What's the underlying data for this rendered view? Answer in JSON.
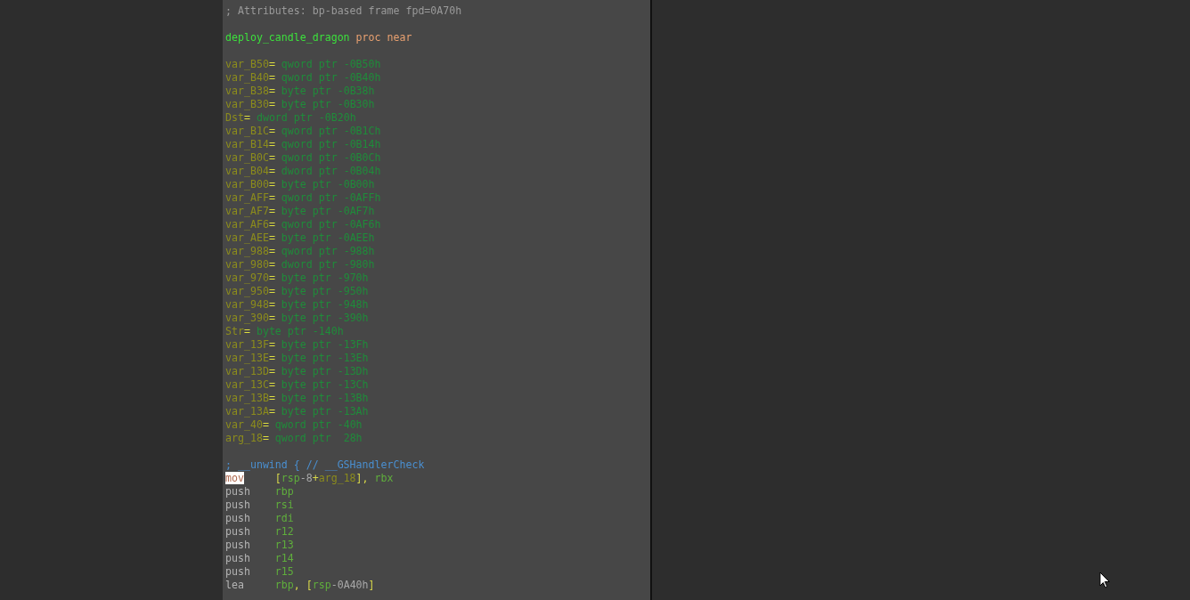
{
  "listing": [
    {
      "kind": "comment",
      "text": "; Attributes: bp-based frame fpd=0A70h"
    },
    {
      "kind": "blank"
    },
    {
      "kind": "proc",
      "name": "deploy_candle_dragon",
      "text": "proc near"
    },
    {
      "kind": "blank"
    },
    {
      "kind": "var",
      "name": "var_B50",
      "sep": "=",
      "type": "qword ptr",
      "offset": "-0B50h"
    },
    {
      "kind": "var",
      "name": "var_B40",
      "sep": "=",
      "type": "qword ptr",
      "offset": "-0B40h"
    },
    {
      "kind": "var",
      "name": "var_B38",
      "sep": "=",
      "type": "byte ptr",
      "offset": "-0B38h"
    },
    {
      "kind": "var",
      "name": "var_B30",
      "sep": "=",
      "type": "byte ptr",
      "offset": "-0B30h"
    },
    {
      "kind": "var",
      "name": "Dst",
      "sep": "=",
      "type": "dword ptr",
      "offset": "-0B20h"
    },
    {
      "kind": "var",
      "name": "var_B1C",
      "sep": "=",
      "type": "qword ptr",
      "offset": "-0B1Ch"
    },
    {
      "kind": "var",
      "name": "var_B14",
      "sep": "=",
      "type": "qword ptr",
      "offset": "-0B14h"
    },
    {
      "kind": "var",
      "name": "var_B0C",
      "sep": "=",
      "type": "qword ptr",
      "offset": "-0B0Ch"
    },
    {
      "kind": "var",
      "name": "var_B04",
      "sep": "=",
      "type": "dword ptr",
      "offset": "-0B04h"
    },
    {
      "kind": "var",
      "name": "var_B00",
      "sep": "=",
      "type": "byte ptr",
      "offset": "-0B00h"
    },
    {
      "kind": "var",
      "name": "var_AFF",
      "sep": "=",
      "type": "qword ptr",
      "offset": "-0AFFh"
    },
    {
      "kind": "var",
      "name": "var_AF7",
      "sep": "=",
      "type": "byte ptr",
      "offset": "-0AF7h"
    },
    {
      "kind": "var",
      "name": "var_AF6",
      "sep": "=",
      "type": "qword ptr",
      "offset": "-0AF6h"
    },
    {
      "kind": "var",
      "name": "var_AEE",
      "sep": "=",
      "type": "byte ptr",
      "offset": "-0AEEh"
    },
    {
      "kind": "var",
      "name": "var_988",
      "sep": "=",
      "type": "qword ptr",
      "offset": "-988h"
    },
    {
      "kind": "var",
      "name": "var_980",
      "sep": "=",
      "type": "dword ptr",
      "offset": "-980h"
    },
    {
      "kind": "var",
      "name": "var_970",
      "sep": "=",
      "type": "byte ptr",
      "offset": "-970h"
    },
    {
      "kind": "var",
      "name": "var_950",
      "sep": "=",
      "type": "byte ptr",
      "offset": "-950h"
    },
    {
      "kind": "var",
      "name": "var_948",
      "sep": "=",
      "type": "byte ptr",
      "offset": "-948h"
    },
    {
      "kind": "var",
      "name": "var_390",
      "sep": "=",
      "type": "byte ptr",
      "offset": "-390h"
    },
    {
      "kind": "var",
      "name": "Str",
      "sep": "=",
      "type": "byte ptr",
      "offset": "-140h"
    },
    {
      "kind": "var",
      "name": "var_13F",
      "sep": "=",
      "type": "byte ptr",
      "offset": "-13Fh"
    },
    {
      "kind": "var",
      "name": "var_13E",
      "sep": "=",
      "type": "byte ptr",
      "offset": "-13Eh"
    },
    {
      "kind": "var",
      "name": "var_13D",
      "sep": "=",
      "type": "byte ptr",
      "offset": "-13Dh"
    },
    {
      "kind": "var",
      "name": "var_13C",
      "sep": "=",
      "type": "byte ptr",
      "offset": "-13Ch"
    },
    {
      "kind": "var",
      "name": "var_13B",
      "sep": "=",
      "type": "byte ptr",
      "offset": "-13Bh"
    },
    {
      "kind": "var",
      "name": "var_13A",
      "sep": "=",
      "type": "byte ptr",
      "offset": "-13Ah"
    },
    {
      "kind": "var",
      "name": "var_40",
      "sep": "=",
      "type": "qword ptr",
      "offset": "-40h"
    },
    {
      "kind": "var",
      "name": "arg_18",
      "sep": "=",
      "type": "qword ptr",
      "offset": " 28h"
    },
    {
      "kind": "blank"
    },
    {
      "kind": "unwind",
      "text": "; __unwind { // __GSHandlerCheck"
    },
    {
      "kind": "insn",
      "mnemonic": "mov",
      "selected": true,
      "operands": [
        {
          "kind": "punct",
          "text": "["
        },
        {
          "kind": "reg",
          "text": "rsp"
        },
        {
          "kind": "num",
          "text": "-8"
        },
        {
          "kind": "punct",
          "text": "+"
        },
        {
          "kind": "var",
          "text": "arg_18"
        },
        {
          "kind": "punct",
          "text": "], "
        },
        {
          "kind": "reg",
          "text": "rbx"
        }
      ]
    },
    {
      "kind": "insn",
      "mnemonic": "push",
      "selected": false,
      "operands": [
        {
          "kind": "reg",
          "text": "rbp"
        }
      ]
    },
    {
      "kind": "insn",
      "mnemonic": "push",
      "selected": false,
      "operands": [
        {
          "kind": "reg",
          "text": "rsi"
        }
      ]
    },
    {
      "kind": "insn",
      "mnemonic": "push",
      "selected": false,
      "operands": [
        {
          "kind": "reg",
          "text": "rdi"
        }
      ]
    },
    {
      "kind": "insn",
      "mnemonic": "push",
      "selected": false,
      "operands": [
        {
          "kind": "reg",
          "text": "r12"
        }
      ]
    },
    {
      "kind": "insn",
      "mnemonic": "push",
      "selected": false,
      "operands": [
        {
          "kind": "reg",
          "text": "r13"
        }
      ]
    },
    {
      "kind": "insn",
      "mnemonic": "push",
      "selected": false,
      "operands": [
        {
          "kind": "reg",
          "text": "r14"
        }
      ]
    },
    {
      "kind": "insn",
      "mnemonic": "push",
      "selected": false,
      "operands": [
        {
          "kind": "reg",
          "text": "r15"
        }
      ]
    },
    {
      "kind": "insn",
      "mnemonic": "lea",
      "selected": false,
      "operands": [
        {
          "kind": "reg",
          "text": "rbp"
        },
        {
          "kind": "punct",
          "text": ", ["
        },
        {
          "kind": "reg",
          "text": "rsp"
        },
        {
          "kind": "num",
          "text": "-0A40h"
        },
        {
          "kind": "punct",
          "text": "]"
        }
      ]
    }
  ]
}
